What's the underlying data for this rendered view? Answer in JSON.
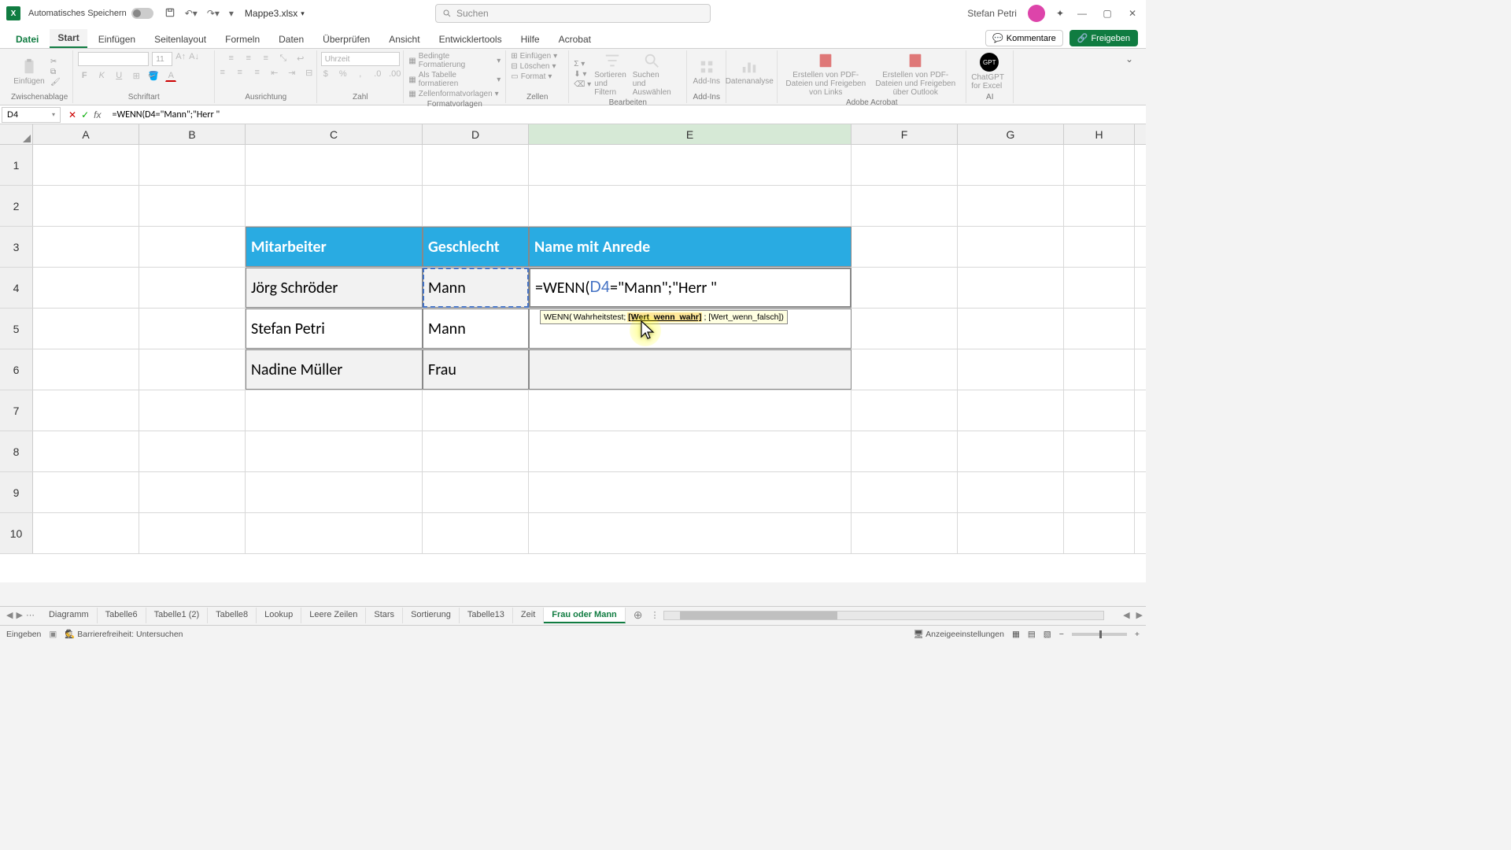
{
  "titlebar": {
    "autosave_label": "Automatisches Speichern",
    "doc_name": "Mappe3.xlsx",
    "search_placeholder": "Suchen",
    "user_name": "Stefan Petri"
  },
  "ribbon_tabs": {
    "datei": "Datei",
    "start": "Start",
    "einfuegen": "Einfügen",
    "seitenlayout": "Seitenlayout",
    "formeln": "Formeln",
    "daten": "Daten",
    "ueberpruefen": "Überprüfen",
    "ansicht": "Ansicht",
    "entwicklertools": "Entwicklertools",
    "hilfe": "Hilfe",
    "acrobat": "Acrobat",
    "kommentare": "Kommentare",
    "freigeben": "Freigeben"
  },
  "ribbon": {
    "zwischenablage": "Zwischenablage",
    "einfuegen_btn": "Einfügen",
    "schriftart": "Schriftart",
    "font_name": "",
    "font_size": "11",
    "ausrichtung": "Ausrichtung",
    "zahl": "Zahl",
    "zahl_format": "Uhrzeit",
    "formatvorlagen": "Formatvorlagen",
    "bedingte": "Bedingte Formatierung",
    "als_tabelle": "Als Tabelle formatieren",
    "zellenformat": "Zellenformatvorlagen",
    "zellen": "Zellen",
    "z_einfuegen": "Einfügen",
    "z_loeschen": "Löschen",
    "z_format": "Format",
    "bearbeiten": "Bearbeiten",
    "sortieren": "Sortieren und Filtern",
    "suchen": "Suchen und Auswählen",
    "addins": "Add-Ins",
    "addins_btn": "Add-Ins",
    "datenanalyse": "Datenanalyse",
    "adobe": "Adobe Acrobat",
    "adobe1": "Erstellen von PDF-Dateien und Freigeben von Links",
    "adobe2": "Erstellen von PDF-Dateien und Freigeben über Outlook",
    "ai": "AI",
    "chatgpt": "ChatGPT for Excel"
  },
  "fbar": {
    "cell_ref": "D4",
    "formula": "=WENN(D4=\"Mann\";\"Herr \""
  },
  "columns": {
    "A": "A",
    "B": "B",
    "C": "C",
    "D": "D",
    "E": "E",
    "F": "F",
    "G": "G",
    "H": "H"
  },
  "rows": [
    "1",
    "2",
    "3",
    "4",
    "5",
    "6",
    "7",
    "8",
    "9",
    "10"
  ],
  "table": {
    "h1": "Mitarbeiter",
    "h2": "Geschlecht",
    "h3": "Name mit Anrede",
    "r1c1": "Jörg Schröder",
    "r1c2": "Mann",
    "r2c1": "Stefan Petri",
    "r2c2": "Mann",
    "r3c1": "Nadine Müller",
    "r3c2": "Frau"
  },
  "edit_cell": {
    "prefix": "=WENN(",
    "ref": "D4",
    "suffix": "=\"Mann\";\"Herr \""
  },
  "tooltip": {
    "fn": "WENN(",
    "arg1": "Wahrheitstest; ",
    "arg2": "[Wert_wenn_wahr]",
    "arg3": "; [Wert_wenn_falsch])"
  },
  "sheet_tabs": [
    "Diagramm",
    "Tabelle6",
    "Tabelle1 (2)",
    "Tabelle8",
    "Lookup",
    "Leere Zeilen",
    "Stars",
    "Sortierung",
    "Tabelle13",
    "Zeit",
    "Frau oder Mann"
  ],
  "active_sheet": "Frau oder Mann",
  "statusbar": {
    "mode": "Eingeben",
    "access": "Barrierefreiheit: Untersuchen",
    "display": "Anzeigeeinstellungen"
  },
  "col_widths": {
    "A": 135,
    "B": 135,
    "C": 225,
    "D": 135,
    "E": 410,
    "F": 135,
    "G": 135,
    "H": 90
  },
  "row_heights": {
    "normal": 52,
    "header": 26
  }
}
